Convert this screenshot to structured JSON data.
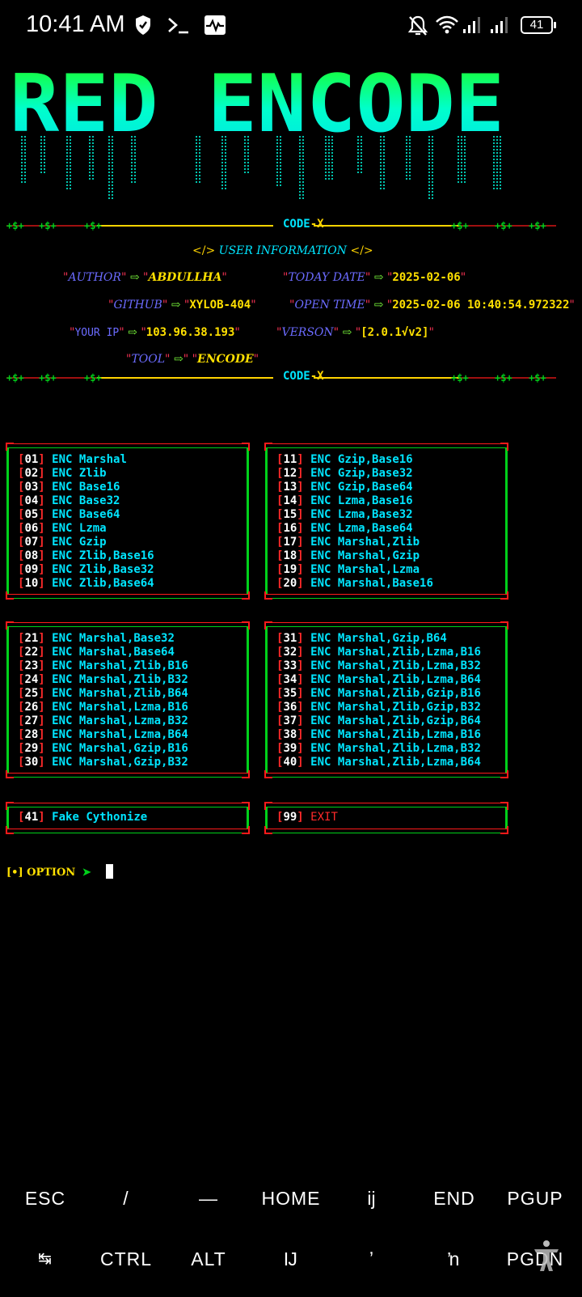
{
  "status_bar": {
    "time": "10:41 AM",
    "battery": "41",
    "icons": [
      "shield-icon",
      "terminal-icon",
      "activity-icon",
      "bell-off-icon",
      "wifi-icon",
      "signal-icon",
      "signal-icon-2",
      "battery-icon"
    ]
  },
  "banner": {
    "text": "RED ENCODE"
  },
  "separator": {
    "label_a": "CODE",
    "label_b": "-X",
    "label_b2": "X"
  },
  "info": {
    "title_open": "</>",
    "title": "USER INFORMATION",
    "title_close": "</>",
    "author_key": "AUTHOR",
    "author_val": "ABDULLHA",
    "today_key": "TODAY DATE",
    "today_val": "2025-02-06",
    "github_key": "GITHUB",
    "github_val": "XYLOB-404",
    "open_key": "OPEN TIME",
    "open_val": "2025-02-06 10:40:54.972322",
    "ip_key": "YOUR IP",
    "ip_val": "103.96.38.193",
    "version_key": "VERSON",
    "version_val": "[2.0.1√v2]",
    "tool_key": "TOOL",
    "tool_val": "ENCODE"
  },
  "menu": {
    "box1": [
      {
        "n": "01",
        "l": "ENC Marshal"
      },
      {
        "n": "02",
        "l": "ENC Zlib"
      },
      {
        "n": "03",
        "l": "ENC Base16"
      },
      {
        "n": "04",
        "l": "ENC Base32"
      },
      {
        "n": "05",
        "l": "ENC Base64"
      },
      {
        "n": "06",
        "l": "ENC Lzma"
      },
      {
        "n": "07",
        "l": "ENC Gzip"
      },
      {
        "n": "08",
        "l": "ENC Zlib,Base16"
      },
      {
        "n": "09",
        "l": "ENC Zlib,Base32"
      },
      {
        "n": "10",
        "l": "ENC Zlib,Base64"
      }
    ],
    "box2": [
      {
        "n": "11",
        "l": "ENC Gzip,Base16"
      },
      {
        "n": "12",
        "l": "ENC Gzip,Base32"
      },
      {
        "n": "13",
        "l": "ENC Gzip,Base64"
      },
      {
        "n": "14",
        "l": "ENC Lzma,Base16"
      },
      {
        "n": "15",
        "l": "ENC Lzma,Base32"
      },
      {
        "n": "16",
        "l": "ENC Lzma,Base64"
      },
      {
        "n": "17",
        "l": "ENC Marshal,Zlib"
      },
      {
        "n": "18",
        "l": "ENC Marshal,Gzip"
      },
      {
        "n": "19",
        "l": "ENC Marshal,Lzma"
      },
      {
        "n": "20",
        "l": "ENC Marshal,Base16"
      }
    ],
    "box3": [
      {
        "n": "21",
        "l": "ENC Marshal,Base32"
      },
      {
        "n": "22",
        "l": "ENC Marshal,Base64"
      },
      {
        "n": "23",
        "l": "ENC Marshal,Zlib,B16"
      },
      {
        "n": "24",
        "l": "ENC Marshal,Zlib,B32"
      },
      {
        "n": "25",
        "l": "ENC Marshal,Zlib,B64"
      },
      {
        "n": "26",
        "l": "ENC Marshal,Lzma,B16"
      },
      {
        "n": "27",
        "l": "ENC Marshal,Lzma,B32"
      },
      {
        "n": "28",
        "l": "ENC Marshal,Lzma,B64"
      },
      {
        "n": "29",
        "l": "ENC Marshal,Gzip,B16"
      },
      {
        "n": "30",
        "l": "ENC Marshal,Gzip,B32"
      }
    ],
    "box4": [
      {
        "n": "31",
        "l": "ENC Marshal,Gzip,B64"
      },
      {
        "n": "32",
        "l": "ENC Marshal,Zlib,Lzma,B16"
      },
      {
        "n": "33",
        "l": "ENC Marshal,Zlib,Lzma,B32"
      },
      {
        "n": "34",
        "l": "ENC Marshal,Zlib,Lzma,B64"
      },
      {
        "n": "35",
        "l": "ENC Marshal,Zlib,Gzip,B16"
      },
      {
        "n": "36",
        "l": "ENC Marshal,Zlib,Gzip,B32"
      },
      {
        "n": "37",
        "l": "ENC Marshal,Zlib,Gzip,B64"
      },
      {
        "n": "38",
        "l": "ENC Marshal,Zlib,Lzma,B16"
      },
      {
        "n": "39",
        "l": "ENC Marshal,Zlib,Lzma,B32"
      },
      {
        "n": "40",
        "l": "ENC Marshal,Zlib,Lzma,B64"
      }
    ],
    "box5": [
      {
        "n": "41",
        "l": "Fake Cythonize"
      }
    ],
    "box6": [
      {
        "n": "99",
        "l": "EXIT"
      }
    ]
  },
  "prompt": {
    "bracket": "[•]",
    "label": "OPTION",
    "arrow": "➤"
  },
  "extra_keys": {
    "row1": [
      "ESC",
      "/",
      "—",
      "HOME",
      "ĳ",
      "END",
      "PGUP"
    ],
    "row2": [
      "↹",
      "CTRL",
      "ALT",
      "Ĳ",
      "ʼ",
      "ŉ",
      "PGDN"
    ]
  },
  "colors": {
    "accent_green": "#00d11a",
    "accent_cyan": "#00e5ff",
    "accent_red": "#ff1a1a",
    "accent_yellow": "#ffe000"
  }
}
